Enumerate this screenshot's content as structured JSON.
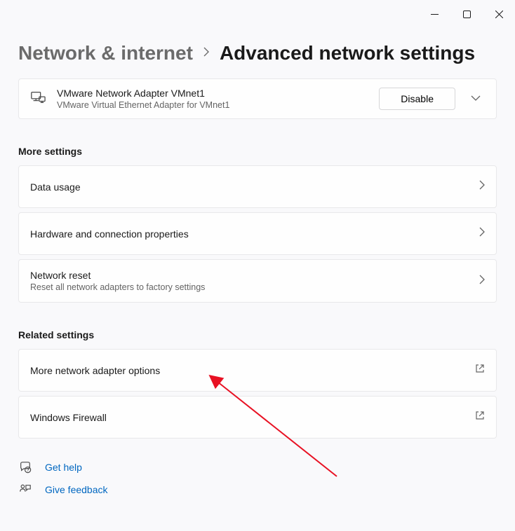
{
  "breadcrumb": {
    "parent": "Network & internet",
    "current": "Advanced network settings"
  },
  "adapter": {
    "title": "VMware Network Adapter VMnet1",
    "subtitle": "VMware Virtual Ethernet Adapter for VMnet1",
    "disable_label": "Disable"
  },
  "sections": {
    "more_settings": "More settings",
    "related_settings": "Related settings"
  },
  "rows": {
    "data_usage": "Data usage",
    "hardware": "Hardware and connection properties",
    "reset_title": "Network reset",
    "reset_sub": "Reset all network adapters to factory settings",
    "more_adapter": "More network adapter options",
    "firewall": "Windows Firewall"
  },
  "footer": {
    "get_help": "Get help",
    "give_feedback": "Give feedback"
  }
}
